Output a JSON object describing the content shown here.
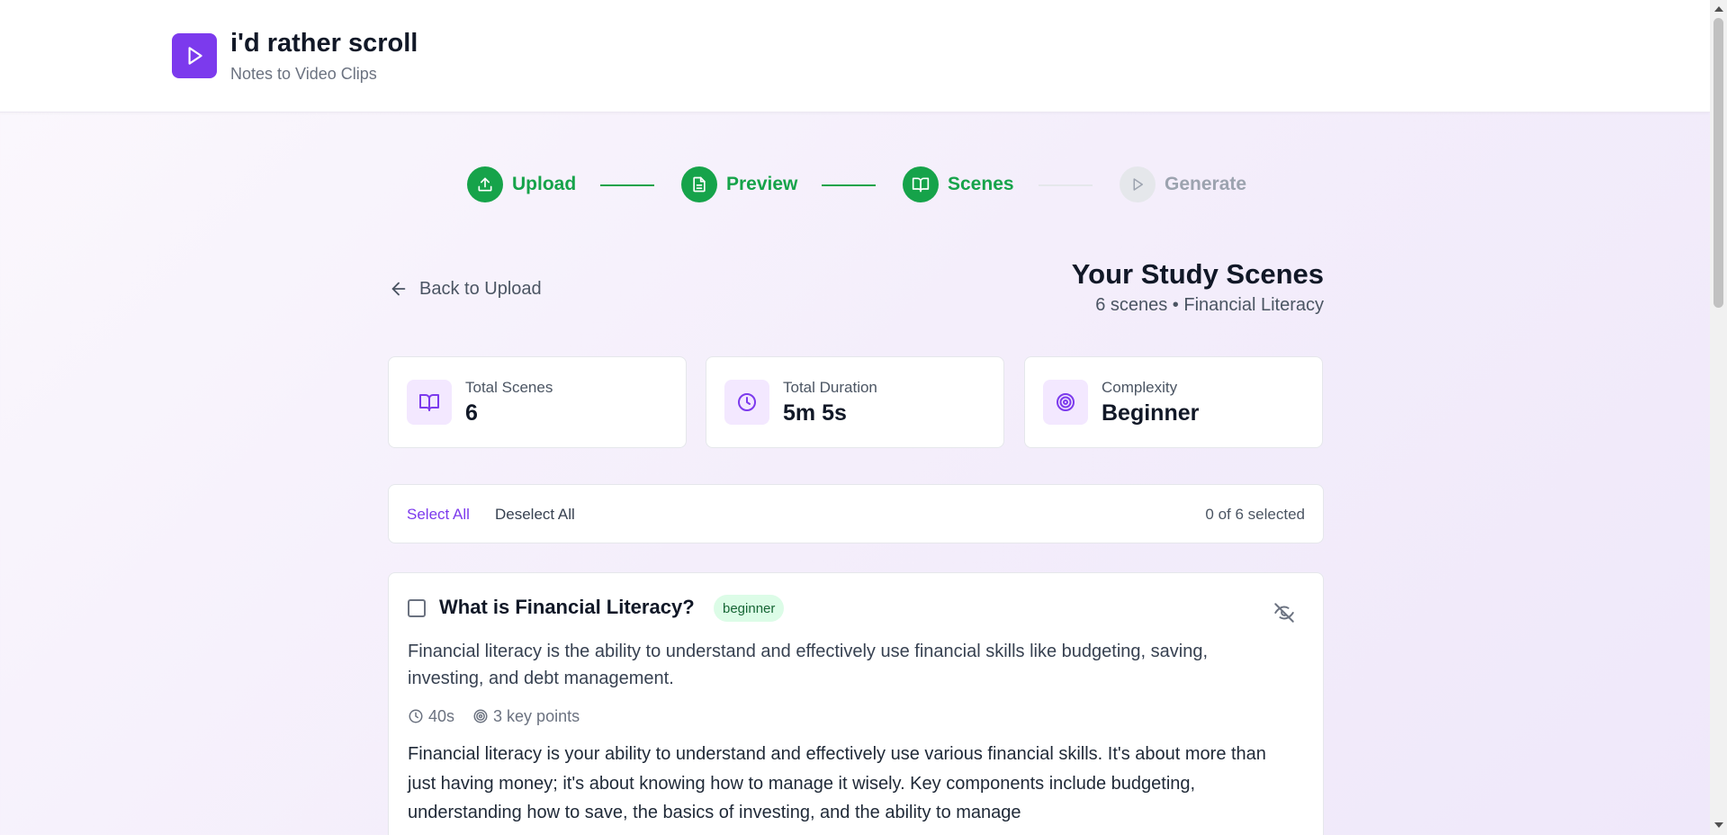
{
  "app": {
    "title": "i'd rather scroll",
    "subtitle": "Notes to Video Clips"
  },
  "stepper": {
    "steps": [
      {
        "label": "Upload",
        "status": "complete",
        "icon": "upload-icon"
      },
      {
        "label": "Preview",
        "status": "complete",
        "icon": "document-icon"
      },
      {
        "label": "Scenes",
        "status": "current",
        "icon": "book-open-icon"
      },
      {
        "label": "Generate",
        "status": "pending",
        "icon": "play-icon"
      }
    ]
  },
  "nav": {
    "back_label": "Back to Upload"
  },
  "page": {
    "title": "Your Study Scenes",
    "subtitle": "6 scenes • Financial Literacy"
  },
  "stats": [
    {
      "label": "Total Scenes",
      "value": "6",
      "icon": "book-open-icon"
    },
    {
      "label": "Total Duration",
      "value": "5m 5s",
      "icon": "clock-icon"
    },
    {
      "label": "Complexity",
      "value": "Beginner",
      "icon": "target-icon"
    }
  ],
  "selection": {
    "select_all_label": "Select All",
    "deselect_all_label": "Deselect All",
    "count_text": "0 of 6 selected"
  },
  "scenes": [
    {
      "title": "What is Financial Literacy?",
      "level": "beginner",
      "summary": "Financial literacy is the ability to understand and effectively use financial skills like budgeting, saving, investing, and debt management.",
      "duration": "40s",
      "key_points": "3 key points",
      "selected": false,
      "body": "Financial literacy is your ability to understand and effectively use various financial skills. It's about more than just having money; it's about knowing how to manage it wisely. Key components include budgeting, understanding how to save, the basics of investing, and the ability to manage"
    }
  ],
  "colors": {
    "brand": "#7c3aed",
    "success": "#16a34a",
    "pending": "#9ca3af"
  }
}
